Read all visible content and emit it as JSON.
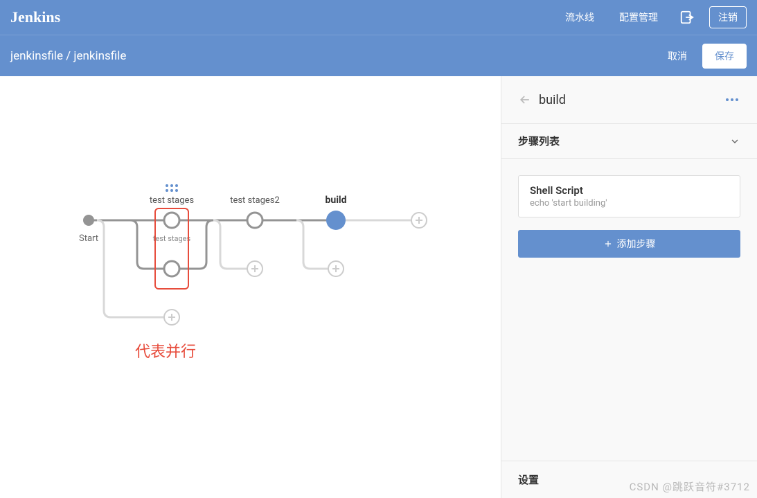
{
  "header": {
    "logo": "Jenkins",
    "nav": {
      "pipeline": "流水线",
      "config": "配置管理"
    },
    "logout": "注销"
  },
  "subheader": {
    "breadcrumb": "jenkinsfile / jenkinsfile",
    "cancel": "取消",
    "save": "保存"
  },
  "pipeline": {
    "start_label": "Start",
    "stages": [
      {
        "name": "test stages",
        "sub_label": "test stages"
      },
      {
        "name": "test stages2"
      },
      {
        "name": "build",
        "selected": true
      }
    ]
  },
  "annotation": "代表并行",
  "sidebar": {
    "title": "build",
    "steps_section": "步骤列表",
    "step": {
      "title": "Shell Script",
      "desc": "echo 'start building'"
    },
    "add_step": "添加步骤",
    "settings": "设置"
  },
  "watermark": "CSDN @跳跃音符#3712"
}
